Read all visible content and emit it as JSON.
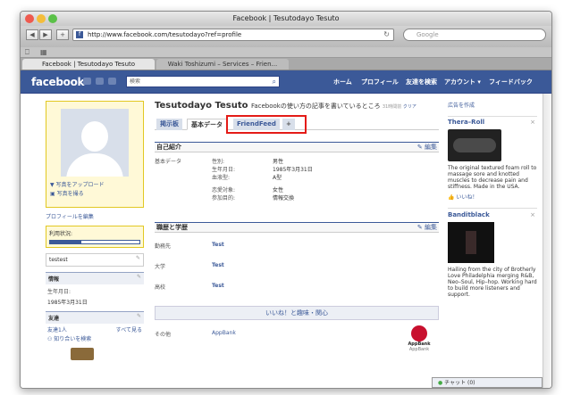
{
  "window": {
    "title": "Facebook | Tesutodayo Tesuto"
  },
  "toolbar": {
    "url": "http://www.facebook.com/tesutodayo?ref=profile",
    "search_placeholder": "Google"
  },
  "tabs": [
    {
      "label": "Facebook | Tesutodayo Tesuto"
    },
    {
      "label": "Waki Toshizumi – Services – Frien..."
    }
  ],
  "fbbar": {
    "logo": "facebook",
    "search_placeholder": "検索",
    "nav": [
      "ホーム",
      "プロフィール",
      "友達を検索",
      "アカウント ▾",
      "フィードバック"
    ]
  },
  "left": {
    "upload_photo": "写真をアップロード",
    "take_photo": "写真を撮る",
    "edit_profile": "プロフィールを編集",
    "usage_label": "利用状況:",
    "usage_fraction": 0.35,
    "status_text": "testest",
    "info_header": "情報",
    "birthday_label": "生年月日:",
    "birthday_value": "1985年3月31日",
    "friends_header": "友達",
    "friends_count": "友達1人",
    "see_all": "すべて見る",
    "find_friends": "知り合いを検索"
  },
  "profile": {
    "name": "Tesutodayo Tesuto",
    "status": "Facebookの使い方の記事を書いているところ",
    "status_time": "31時間前",
    "clear": "クリア",
    "tabs": [
      "掲示板",
      "基本データ",
      "FriendFeed"
    ],
    "add_tab": "+"
  },
  "about": {
    "header": "自己紹介",
    "edit": "✎ 編集",
    "section_label": "基本データ",
    "rows": [
      {
        "k": "性別:",
        "v": "男性"
      },
      {
        "k": "生年月日:",
        "v": "1985年3月31日"
      },
      {
        "k": "血液型:",
        "v": "A型"
      },
      {
        "k": "恋愛対象:",
        "v": "女性"
      },
      {
        "k": "参加目的:",
        "v": "情報交換"
      }
    ]
  },
  "edu": {
    "header": "職歴と学歴",
    "edit": "✎ 編集",
    "rows": [
      {
        "k": "勤務先",
        "v": "Test"
      },
      {
        "k": "大学",
        "v": "Test"
      },
      {
        "k": "高校",
        "v": "Test"
      }
    ]
  },
  "likes": {
    "header": "いいね！と趣味・関心",
    "other_label": "その他",
    "other_value": "AppBank",
    "logo_text": "AppBank",
    "logo_caption": "AppBank"
  },
  "ads": {
    "create": "広告を作成",
    "ad1": {
      "title": "Thera–Roll",
      "text": "The original textured foam roll to massage sore and knotted muscles to decrease pain and stiffness. Made in the USA.",
      "like": "いいね！"
    },
    "ad2": {
      "title": "Banditblack",
      "text": "Hailing from the city of Brotherly Love Philadelphia merging R&B, Neo–Soul, Hip–hop. Working hard to build more listeners and support."
    }
  },
  "chat": {
    "label": "チャット (0)"
  },
  "colors": {
    "facebook_blue": "#3b5998",
    "highlight_red": "#e41b17"
  }
}
